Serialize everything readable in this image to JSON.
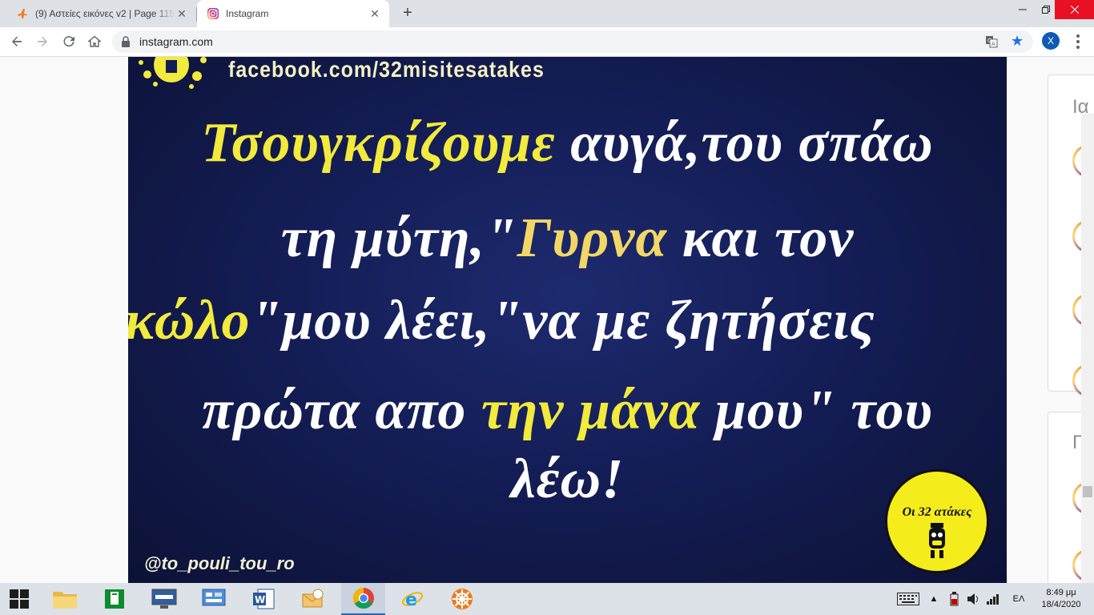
{
  "browser": {
    "tabs": [
      {
        "title": "(9) Αστείες εικόνες v2 | Page 115",
        "icon": "plane-icon",
        "active": false
      },
      {
        "title": "Instagram",
        "icon": "instagram-icon",
        "active": true
      }
    ],
    "url": "instagram.com",
    "profile_initial": "X",
    "accent_color": "#1a73e8"
  },
  "post": {
    "watermark_top": "facebook.com/32misitesatakes",
    "line1": {
      "part1": "Τσουγκρίζουμε",
      "part2": " αυγά,του σπάω"
    },
    "line2": {
      "part1": "τη μύτη,\"",
      "part2": "Γυρνα",
      "part3": " και τον"
    },
    "line3": {
      "part1": "κώλο",
      "part2": "\"μου λέει,\"να με ζητήσεις"
    },
    "line4": {
      "part1": "πρώτα απο ",
      "part2": "την μάνα",
      "part3": " μου\" του"
    },
    "line5": "λέω!",
    "handle": "@to_pouli_tou_ro",
    "logo_text": "Οι 32 ατάκες",
    "colors": {
      "background": "#141d55",
      "yellow": "#f2ea3c",
      "white": "#ffffff"
    }
  },
  "sidebar": {
    "heading1": "Ια",
    "heading2": "Π"
  },
  "taskbar": {
    "language": "ΕΛ",
    "time": "8:49 μμ",
    "date": "18/4/2020"
  }
}
